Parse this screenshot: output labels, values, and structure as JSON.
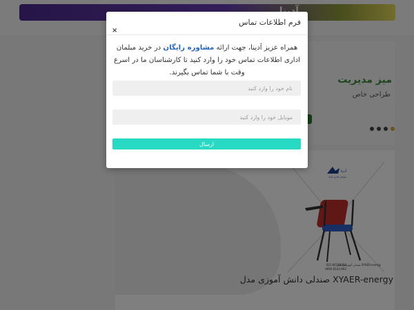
{
  "background": {
    "banner_text": "آدینا",
    "hero_title": "میز مدیریت",
    "hero_subtitle": "طراحی خاص",
    "product_title": "صندلی دانش آموزی مدل XYAER-energy",
    "product_brand": "آدینا",
    "product_brand_sub": "مبلمان اداری آدینا",
    "product_caption": "صندلی آموزشی مدل XYAER-energy",
    "product_phone_1": "021-66128090",
    "product_phone_2": "0992-8143-992"
  },
  "modal": {
    "title": "فرم اطلاعات تماس",
    "close_label": "×",
    "intro_before": "همراه عزیز آدینا، جهت ارائه ",
    "intro_highlight": "مشاوره رایگان",
    "intro_after": " در خرید مبلمان اداری اطلاعات تماس خود را وارد کنید تا کارشناسان ما در اسرع وقت با شما تماس بگیرند.",
    "name_placeholder": "نام خود را وارد کنید",
    "mobile_placeholder": "موبایل خود را وارد کنید",
    "submit_label": "ارسال"
  },
  "colors": {
    "submit": "#28d9c3",
    "highlight": "#2a67b8"
  }
}
